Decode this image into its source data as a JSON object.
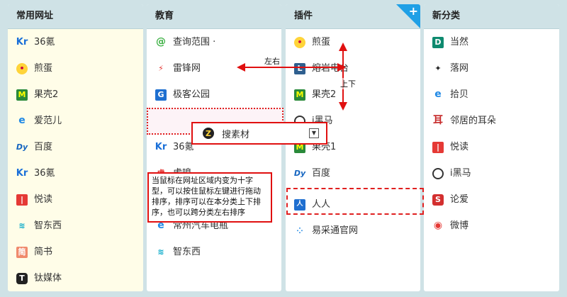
{
  "columns": [
    {
      "title": "常用网址",
      "items": [
        {
          "label": "36氪",
          "icon": "kr-icon"
        },
        {
          "label": "煎蛋",
          "icon": "chick-icon"
        },
        {
          "label": "果壳2",
          "icon": "guokr-icon"
        },
        {
          "label": "爱范儿",
          "icon": "ie-icon"
        },
        {
          "label": "百度",
          "icon": "baidu-icon"
        },
        {
          "label": "36氪",
          "icon": "kr-icon"
        },
        {
          "label": "悦读",
          "icon": "read-icon"
        },
        {
          "label": "智东西",
          "icon": "zdx-icon"
        },
        {
          "label": "简书",
          "icon": "jianshu-icon"
        },
        {
          "label": "钛媒体",
          "icon": "tmt-icon"
        }
      ]
    },
    {
      "title": "教育",
      "items": [
        {
          "label": "查询范围 ·",
          "icon": "search-range-icon"
        },
        {
          "label": "雷锋网",
          "icon": "leifeng-icon"
        },
        {
          "label": "极客公园",
          "icon": "geek-icon"
        },
        {
          "label": "",
          "icon": ""
        },
        {
          "label": "36氪",
          "icon": "kr-icon"
        },
        {
          "label": "虎嗅",
          "icon": "huxiu-icon"
        },
        {
          "label": "",
          "icon": ""
        },
        {
          "label": "常州汽车电瓶",
          "icon": "ie-icon"
        },
        {
          "label": "智东西",
          "icon": "zdx-icon"
        }
      ]
    },
    {
      "title": "插件",
      "items": [
        {
          "label": "煎蛋",
          "icon": "chick-icon"
        },
        {
          "label": "熔岩电台",
          "icon": "radio-icon"
        },
        {
          "label": "果壳2",
          "icon": "guokr-icon"
        },
        {
          "label": "i黑马",
          "icon": "heima-icon"
        },
        {
          "label": "果壳1",
          "icon": "guokr-icon"
        },
        {
          "label": "百度",
          "icon": "baidu-icon"
        },
        {
          "label": "人人",
          "icon": "renren-icon"
        },
        {
          "label": "易采通官网",
          "icon": "yicai-icon"
        }
      ]
    },
    {
      "title": "新分类",
      "items": [
        {
          "label": "当然",
          "icon": "dangran-icon"
        },
        {
          "label": "落网",
          "icon": "luowang-icon"
        },
        {
          "label": "拾贝",
          "icon": "ie-icon"
        },
        {
          "label": "邻居的耳朵",
          "icon": "ear-icon"
        },
        {
          "label": "悦读",
          "icon": "read-icon"
        },
        {
          "label": "i黑马",
          "icon": "heima-icon"
        },
        {
          "label": "论爱",
          "icon": "lunai-icon"
        },
        {
          "label": "微博",
          "icon": "weibo-icon"
        }
      ]
    }
  ],
  "drag_item": {
    "label": "搜素材",
    "icon": "sucai-icon",
    "dropdown_icon": "chevron-down-icon"
  },
  "annotations": {
    "left_right": "左右",
    "up_down": "上下",
    "tip": "当鼠标在网址区域内变为十字型，可以按住鼠标左键进行拖动排序，排序可以在本分类上下排序，也可以跨分类左右排序"
  },
  "colors": {
    "accent": "#1fa0e6",
    "highlight": "#e02020",
    "background": "#cfe2e6"
  }
}
